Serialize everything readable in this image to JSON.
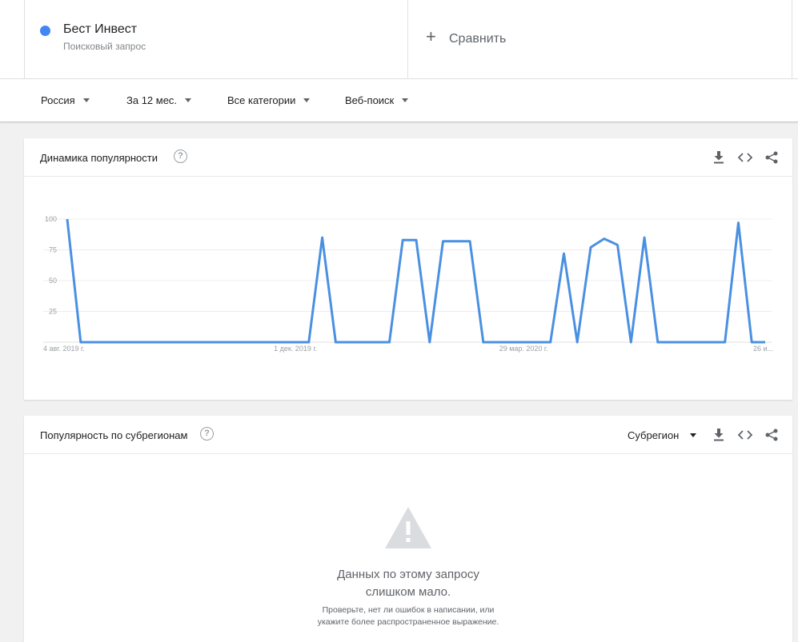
{
  "term": {
    "name": "Бест Инвест",
    "type": "Поисковый запрос",
    "dot_color": "#4285f4"
  },
  "compare": {
    "label": "Сравнить",
    "icon": "plus-icon"
  },
  "filters": [
    {
      "label": "Россия"
    },
    {
      "label": "За 12 мес."
    },
    {
      "label": "Все категории"
    },
    {
      "label": "Веб-поиск"
    }
  ],
  "interest_over_time": {
    "title": "Динамика популярности",
    "help_icon": "help-circle-icon",
    "actions": [
      "download-icon",
      "embed-code-icon",
      "share-icon"
    ]
  },
  "chart_data": {
    "type": "line",
    "title": "",
    "xlabel": "",
    "ylabel": "",
    "ylim": [
      0,
      100
    ],
    "yticks": [
      25,
      50,
      75,
      100
    ],
    "grid": true,
    "line_color": "#4a90e2",
    "x_tick_labels": [
      {
        "index": 0,
        "label": "4 авг. 2019 г."
      },
      {
        "index": 17,
        "label": "1 дек. 2019 г."
      },
      {
        "index": 34,
        "label": "29 мар. 2020 г."
      },
      {
        "index": 51,
        "label": "26 и..."
      }
    ],
    "series": [
      {
        "values": [
          100,
          0,
          0,
          0,
          0,
          0,
          0,
          0,
          0,
          0,
          0,
          0,
          0,
          0,
          0,
          0,
          0,
          0,
          0,
          85,
          0,
          0,
          0,
          0,
          0,
          83,
          83,
          0,
          82,
          82,
          82,
          0,
          0,
          0,
          0,
          0,
          0,
          72,
          0,
          77,
          84,
          79,
          0,
          85,
          0,
          0,
          0,
          0,
          0,
          0,
          97,
          0,
          0
        ]
      }
    ]
  },
  "subregion": {
    "title": "Популярность по субрегионам",
    "help_icon": "help-circle-icon",
    "select_label": "Субрегион",
    "actions": [
      "download-icon",
      "embed-code-icon",
      "share-icon"
    ],
    "empty_icon": "warning-icon",
    "empty_title_line1": "Данных по этому запросу",
    "empty_title_line2": "слишком мало.",
    "empty_sub_line1": "Проверьте, нет ли ошибок в написании, или",
    "empty_sub_line2": "укажите более распространенное выражение."
  }
}
